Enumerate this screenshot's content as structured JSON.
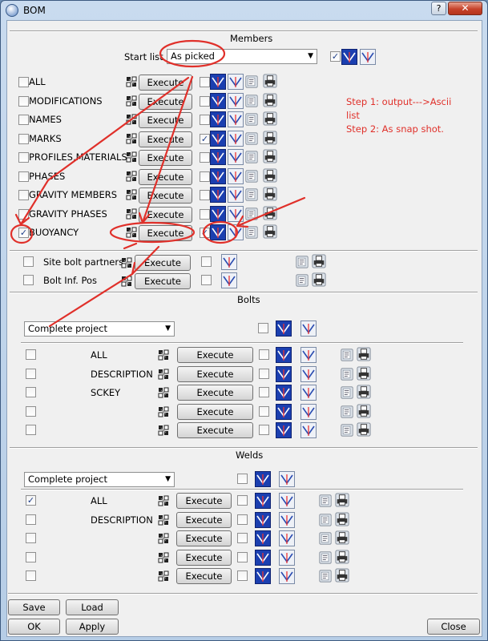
{
  "window": {
    "title": "BOM",
    "help": "?",
    "close_glyph": "✕"
  },
  "members": {
    "section_title": "Members",
    "start_list_label": "Start list",
    "start_list_value": "As picked",
    "header_checked": true,
    "rows": [
      {
        "label": "ALL",
        "checked": false,
        "b_checked": false
      },
      {
        "label": "MODIFICATIONS",
        "checked": false,
        "b_checked": false
      },
      {
        "label": "NAMES",
        "checked": false,
        "b_checked": false
      },
      {
        "label": "MARKS",
        "checked": false,
        "b_checked": true
      },
      {
        "label": "PROFILES,MATERIALS",
        "checked": false,
        "b_checked": false
      },
      {
        "label": "PHASES",
        "checked": false,
        "b_checked": false
      },
      {
        "label": "GRAVITY MEMBERS",
        "checked": false,
        "b_checked": false
      },
      {
        "label": "GRAVITY PHASES",
        "checked": false,
        "b_checked": false
      },
      {
        "label": "BUOYANCY",
        "checked": true,
        "b_checked": true
      }
    ],
    "extra_rows": [
      {
        "label": "Site bolt partners"
      },
      {
        "label": "Bolt Inf. Pos"
      }
    ],
    "execute_label": "Execute"
  },
  "bolts": {
    "section_title": "Bolts",
    "scope_value": "Complete project",
    "rows": [
      {
        "label": "ALL"
      },
      {
        "label": "DESCRIPTION"
      },
      {
        "label": "SCKEY"
      },
      {
        "label": ""
      },
      {
        "label": ""
      }
    ],
    "execute_label": "Execute"
  },
  "welds": {
    "section_title": "Welds",
    "scope_value": "Complete project",
    "rows": [
      {
        "label": "ALL",
        "checked": true
      },
      {
        "label": "DESCRIPTION",
        "checked": false
      },
      {
        "label": "",
        "checked": false
      },
      {
        "label": "",
        "checked": false
      },
      {
        "label": "",
        "checked": false
      }
    ],
    "execute_label": "Execute"
  },
  "footer": {
    "save": "Save",
    "load": "Load",
    "ok": "OK",
    "apply": "Apply",
    "close": "Close"
  },
  "annotation": {
    "lines": [
      "Step 1: output--->Ascii",
      "list",
      "Step 2: As snap shot."
    ],
    "color": "#e0302a"
  }
}
